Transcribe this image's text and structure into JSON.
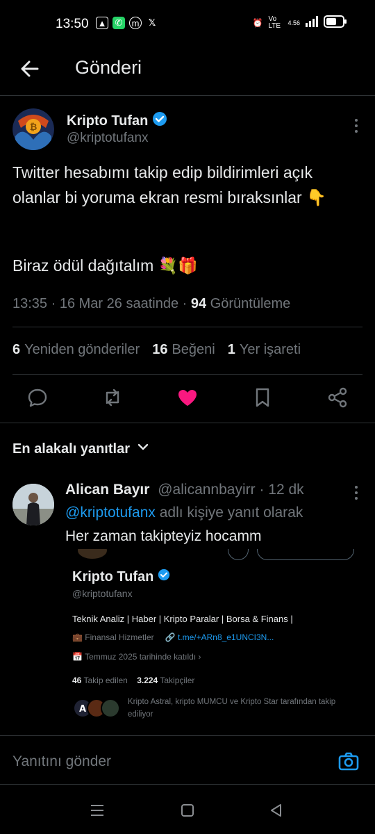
{
  "status_bar": {
    "time": "13:50",
    "network": "Vo LTE",
    "speed": "4.56"
  },
  "header": {
    "title": "Gönderi"
  },
  "post": {
    "author_name": "Kripto Tufan",
    "author_handle": "@kriptotufanx",
    "text_line1": "Twitter hesabımı takip edip bildirimleri açık olanlar bi yoruma ekran resmi bıraksınlar 👇",
    "text_line2": "Biraz ödül dağıtalım 💐🎁",
    "time": "13:35",
    "date": "16 Mar 26 saatinde",
    "views_count": "94",
    "views_label": "Görüntüleme"
  },
  "stats": {
    "reposts_count": "6",
    "reposts_label": "Yeniden gönderiler",
    "likes_count": "16",
    "likes_label": "Beğeni",
    "bookmarks_count": "1",
    "bookmarks_label": "Yer işareti"
  },
  "replies_section": {
    "title": "En alakalı yanıtlar"
  },
  "reply": {
    "name": "Alican Bayır",
    "handle": "@alicannbayirr",
    "time": "12 dk",
    "reply_to_mention": "@kriptotufanx",
    "reply_to_suffix": " adlı kişiye yanıt olarak",
    "text": "Her zaman takipteyiz hocamm"
  },
  "embed": {
    "name": "Kripto Tufan",
    "handle": "@kriptotufanx",
    "bio": "Teknik Analiz | Haber | Kripto Paralar | Borsa & Finans |",
    "category": "Finansal Hizmetler",
    "link": "t.me/+ARn8_e1UNCI3N...",
    "joined": "Temmuz 2025 tarihinde katıldı",
    "following_count": "46",
    "following_label": "Takip edilen",
    "followers_count": "3.224",
    "followers_label": "Takipçiler",
    "mutuals": "Kripto Astral, kripto MUMCU ve Kripto Star tarafından takip ediliyor"
  },
  "composer": {
    "placeholder": "Yanıtını gönder"
  },
  "colors": {
    "accent": "#1d9bf0",
    "like": "#f91880",
    "muted": "#71767b",
    "background": "#000000"
  },
  "icons": [
    "back-arrow-icon",
    "verified-badge-icon",
    "more-icon",
    "reply-icon",
    "repost-icon",
    "like-icon",
    "bookmark-icon",
    "share-icon",
    "chevron-down-icon",
    "camera-icon"
  ]
}
